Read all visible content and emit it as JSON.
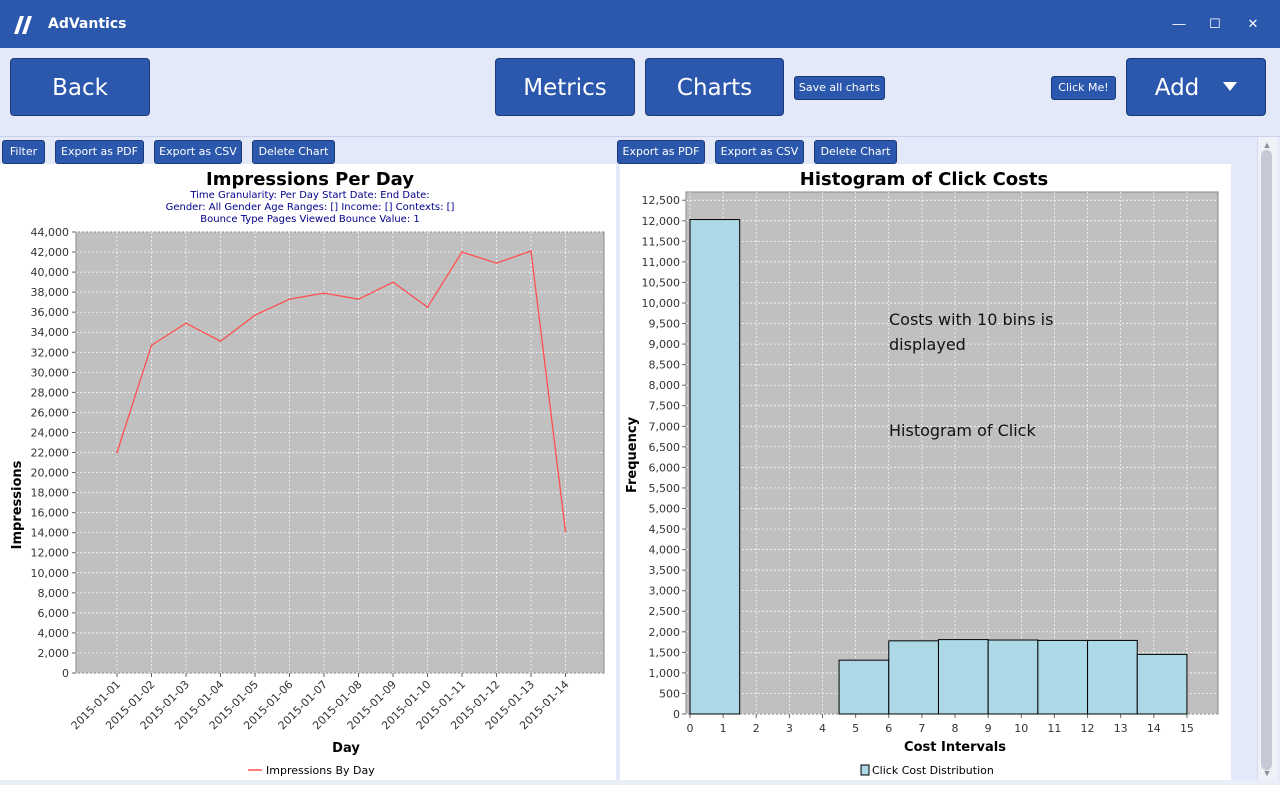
{
  "app": {
    "title": "AdVantics"
  },
  "window_controls": {
    "minimize": "—",
    "maximize": "☐",
    "close": "✕"
  },
  "toolbar": {
    "back_label": "Back",
    "metrics_label": "Metrics",
    "charts_label": "Charts",
    "save_all_label": "Save all charts",
    "click_me_label": "Click Me!",
    "add_label": "Add"
  },
  "left_panel": {
    "filter_label": "Filter",
    "export_pdf_label": "Export as PDF",
    "export_csv_label": "Export as CSV",
    "delete_label": "Delete Chart"
  },
  "right_panel": {
    "export_pdf_label": "Export as PDF",
    "export_csv_label": "Export as CSV",
    "delete_label": "Delete Chart",
    "annotation_lines": [
      "Histogram of Click",
      "Costs with 10 bins is",
      "displayed"
    ]
  },
  "colors": {
    "accent": "#2b57ad",
    "plot_bg": "#c0c0c0",
    "line_series": "#ff5050",
    "bar_fill": "#add8e6",
    "subtitle": "#00008b"
  },
  "chart_data": [
    {
      "type": "line",
      "title": "Impressions Per Day",
      "subtitle_lines": [
        "Time Granularity: Per Day   Start Date:    End Date:",
        "Gender: All Gender   Age Ranges: []   Income: []   Contexts: []",
        "Bounce Type Pages Viewed   Bounce Value: 1"
      ],
      "xlabel": "Day",
      "ylabel": "Impressions",
      "x": [
        "2015-01-01",
        "2015-01-02",
        "2015-01-03",
        "2015-01-04",
        "2015-01-05",
        "2015-01-06",
        "2015-01-07",
        "2015-01-08",
        "2015-01-09",
        "2015-01-10",
        "2015-01-11",
        "2015-01-12",
        "2015-01-13",
        "2015-01-14"
      ],
      "series": [
        {
          "name": "Impressions By Day",
          "values": [
            22000,
            32700,
            34900,
            33100,
            35700,
            37300,
            37900,
            37300,
            39000,
            36500,
            42000,
            40900,
            42100,
            14100
          ]
        }
      ],
      "ylim": [
        0,
        44000
      ],
      "yticks": [
        "0",
        "2,000",
        "4,000",
        "6,000",
        "8,000",
        "10,000",
        "12,000",
        "14,000",
        "16,000",
        "18,000",
        "20,000",
        "22,000",
        "24,000",
        "26,000",
        "28,000",
        "30,000",
        "32,000",
        "34,000",
        "36,000",
        "38,000",
        "40,000",
        "42,000",
        "44,000"
      ],
      "grid": true,
      "legend": "bottom"
    },
    {
      "type": "bar",
      "title": "Histogram of Click Costs",
      "xlabel": "Cost Intervals",
      "ylabel": "Frequency",
      "bins": [
        {
          "from": 0,
          "to": 1.5,
          "value": 12030
        },
        {
          "from": 4.5,
          "to": 6,
          "value": 1310
        },
        {
          "from": 6,
          "to": 7.5,
          "value": 1780
        },
        {
          "from": 7.5,
          "to": 9,
          "value": 1810
        },
        {
          "from": 9,
          "to": 10.5,
          "value": 1800
        },
        {
          "from": 10.5,
          "to": 12,
          "value": 1790
        },
        {
          "from": 12,
          "to": 13.5,
          "value": 1790
        },
        {
          "from": 13.5,
          "to": 15,
          "value": 1450
        }
      ],
      "series": [
        {
          "name": "Click Cost Distribution"
        }
      ],
      "xlim": [
        0,
        15.9
      ],
      "xticks": [
        "0",
        "1",
        "2",
        "3",
        "4",
        "5",
        "6",
        "7",
        "8",
        "9",
        "10",
        "11",
        "12",
        "13",
        "14",
        "15"
      ],
      "ylim": [
        0,
        12700
      ],
      "yticks": [
        "0",
        "500",
        "1,000",
        "1,500",
        "2,000",
        "2,500",
        "3,000",
        "3,500",
        "4,000",
        "4,500",
        "5,000",
        "5,500",
        "6,000",
        "6,500",
        "7,000",
        "7,500",
        "8,000",
        "8,500",
        "9,000",
        "9,500",
        "10,000",
        "10,500",
        "11,000",
        "11,500",
        "12,000",
        "12,500"
      ],
      "grid": true,
      "legend": "bottom"
    }
  ]
}
